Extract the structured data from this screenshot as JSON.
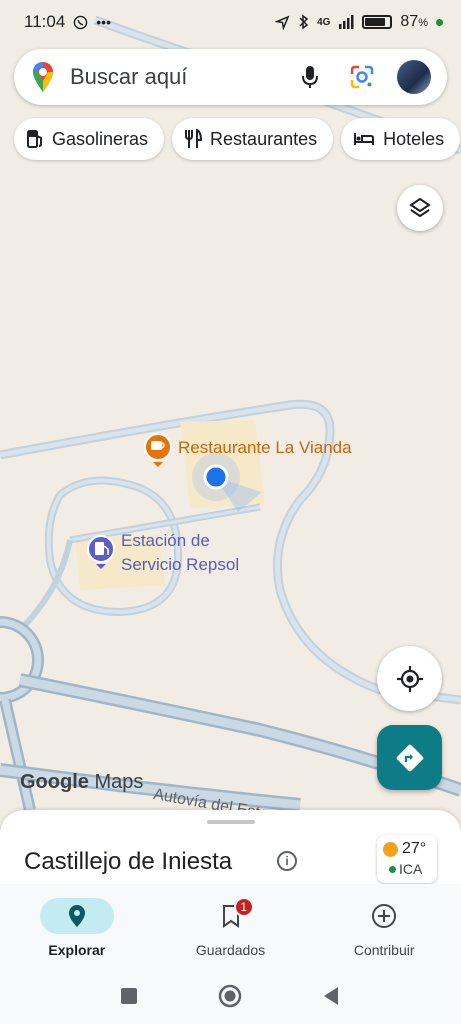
{
  "status_bar": {
    "time": "11:04",
    "battery_percent": "87",
    "battery_unit": "%",
    "network": "4G",
    "icons": [
      "whatsapp-icon",
      "more-icon",
      "location-arrow-icon",
      "bluetooth-icon",
      "signal-icon",
      "battery-icon"
    ]
  },
  "search": {
    "placeholder": "Buscar aquí",
    "icons": [
      "maps-pin-logo",
      "microphone-icon",
      "lens-icon",
      "avatar"
    ]
  },
  "chips": [
    {
      "label": "Gasolineras",
      "icon": "gas-station-icon"
    },
    {
      "label": "Restaurantes",
      "icon": "restaurant-icon"
    },
    {
      "label": "Hoteles",
      "icon": "hotel-icon"
    }
  ],
  "map": {
    "places": [
      {
        "name": "Restaurante La Vianda",
        "type": "restaurant",
        "color": "#e8710a"
      },
      {
        "name_line1": "Estación de",
        "name_line2": "Servicio Repsol",
        "type": "gas-station",
        "color": "#5c5fc7"
      }
    ],
    "road_label": "Autovía del Este",
    "logo_bold": "Google",
    "logo_rest": " Maps"
  },
  "sheet": {
    "title": "Castillejo de Iniesta",
    "info_glyph": "i",
    "weather": {
      "temp": "27°",
      "aqi_label": "ICA"
    }
  },
  "nav": {
    "explore": "Explorar",
    "saved": "Guardados",
    "saved_badge": "1",
    "contribute": "Contribuir"
  },
  "colors": {
    "accent": "#0e7c86",
    "map_bg": "#f2ede4",
    "road": "#b9cad9",
    "location_blue": "#1a73e8"
  }
}
